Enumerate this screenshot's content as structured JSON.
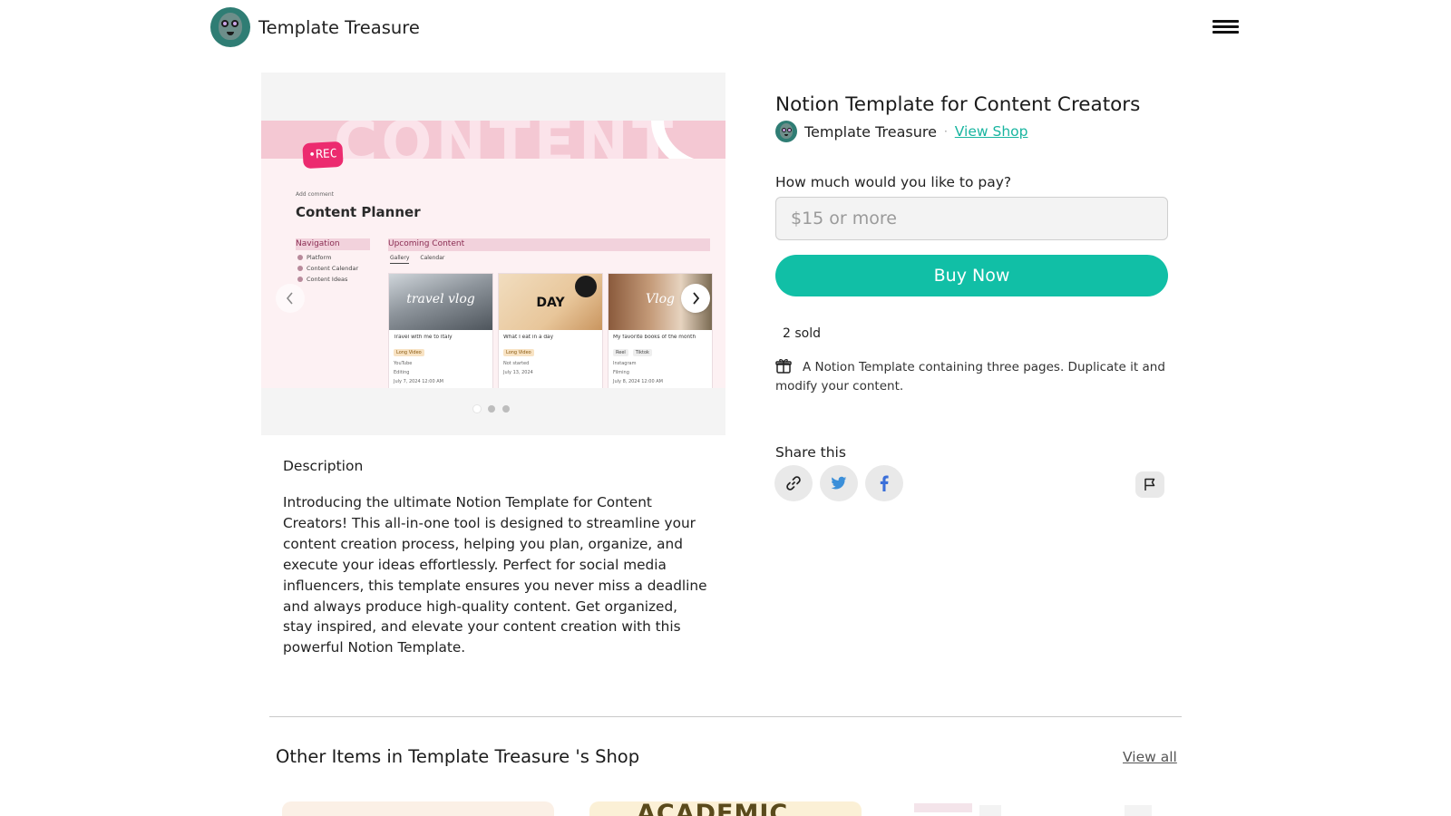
{
  "header": {
    "brand_name": "Template Treasure",
    "menu_icon": "hamburger-menu-icon"
  },
  "carousel": {
    "slide": {
      "banner_text": "CONTENT",
      "rec_badge": "•REC",
      "add_comment": "Add comment",
      "planner_title": "Content Planner",
      "navigation_title": "Navigation",
      "navigation_items": [
        "Platform",
        "Content Calendar",
        "Content Ideas"
      ],
      "upcoming_title": "Upcoming Content",
      "upcoming_tabs": [
        "Gallery",
        "Calendar"
      ],
      "cards": [
        {
          "overlay": "travel vlog",
          "title": "Travel with me to Italy",
          "tag": "Long Video",
          "platform": "YouTube",
          "status": "Editing",
          "date": "July 7, 2024 12:00 AM"
        },
        {
          "overlay": "DAY",
          "title": "What I eat in a day",
          "tag": "Long Video",
          "status": "Not started",
          "date": "July 13, 2024"
        },
        {
          "overlay": "Vlog",
          "title": "My favorite books of the month",
          "tag": "Reel",
          "tag2": "Tiktok",
          "platform": "Instagram",
          "status": "Filming",
          "date": "July 8, 2024 12:00 AM"
        }
      ]
    },
    "prev_icon": "chevron-left-icon",
    "next_icon": "chevron-right-icon",
    "slide_count": 3,
    "active_slide": 1
  },
  "description": {
    "label": "Description",
    "text": "Introducing the ultimate Notion Template for Content Creators! This all-in-one tool is designed to streamline your content creation process, helping you plan, organize, and execute your ideas effortlessly. Perfect for social media influencers, this template ensures you never miss a deadline and always produce high-quality content. Get organized, stay inspired, and elevate your content creation with this powerful Notion Template."
  },
  "product": {
    "title": "Notion Template for Content Creators",
    "seller_name": "Template Treasure",
    "separator": "·",
    "view_shop_label": "View Shop",
    "pay_label": "How much would you like to pay?",
    "pay_placeholder": "$15 or more",
    "buy_label": "Buy Now",
    "sold_text": "2 sold",
    "info_text": "A Notion Template containing three pages. Duplicate it and modify your content.",
    "info_icon": "gift-box-icon"
  },
  "share": {
    "label": "Share this",
    "buttons": [
      "link-icon",
      "twitter-icon",
      "facebook-icon"
    ],
    "report_icon": "flag-icon"
  },
  "other_items": {
    "title": "Other Items in Template Treasure 's Shop",
    "view_all_label": "View all",
    "card2_heading": "ACADEMIC"
  },
  "colors": {
    "accent": "#11bfa6",
    "link": "#18b5a0",
    "avatar_bg": "#2f7d74",
    "rec_badge": "#ec2b6f"
  }
}
